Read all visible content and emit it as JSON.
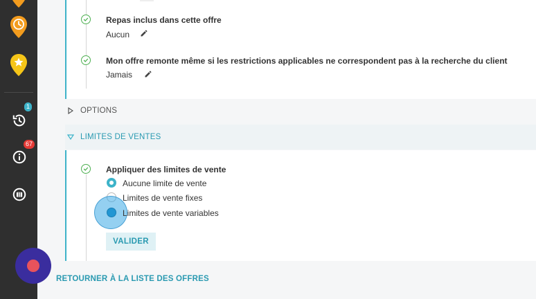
{
  "sidebar": {
    "history_badge": "1",
    "info_badge": "67"
  },
  "rows": [
    {
      "title": "Repas inclus dans cette offre",
      "value": "Aucun"
    },
    {
      "title": "Mon offre remonte même si les restrictions applicables ne correspondent pas à la recherche du client",
      "value": "Jamais"
    }
  ],
  "sections": {
    "options_label": "OPTIONS",
    "limites_label": "LIMITES DE VENTES"
  },
  "limits": {
    "title": "Appliquer des limites de vente",
    "options": [
      "Aucune limite de vente",
      "Limites de vente fixes",
      "Limites de vente variables"
    ],
    "selected": "Aucune limite de vente",
    "submit_label": "VALIDER"
  },
  "footer": {
    "back_link": "RETOURNER À LA LISTE DES OFFRES"
  },
  "colors": {
    "accent": "#3db3c9",
    "link": "#2a9ab1",
    "check": "#4caf50",
    "pin_orange": "#f39c1e",
    "pin_yellow": "#f5c518",
    "sidebar": "#2f2f2f",
    "rec_outer": "#3a2d9e",
    "rec_inner": "#e8535c"
  }
}
